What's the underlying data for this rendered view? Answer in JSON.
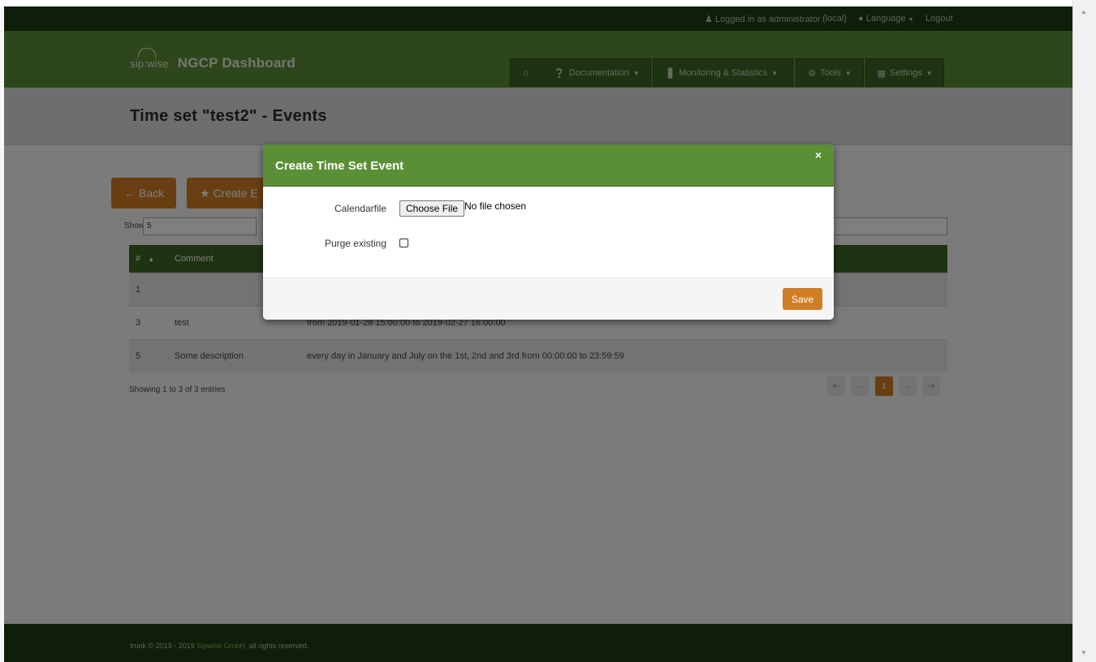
{
  "topbar": {
    "logged_in": "Logged in as administrator",
    "realm": "(local)",
    "language": "Language",
    "logout": "Logout"
  },
  "brand": {
    "logo_text": "sip:wise",
    "title": "NGCP Dashboard"
  },
  "nav": {
    "home_icon": "home-icon",
    "documentation": "Documentation",
    "monitoring": "Monitoring & Statistics",
    "tools": "Tools",
    "settings": "Settings"
  },
  "page": {
    "title": "Time set \"test2\" - Events"
  },
  "actions": {
    "back": "Back",
    "create": "Create E"
  },
  "list_controls": {
    "show_label": "Show",
    "show_value": "5"
  },
  "table": {
    "columns": [
      "#",
      "Comment",
      "",
      ""
    ],
    "rows": [
      {
        "id": "1",
        "comment": "",
        "description": ""
      },
      {
        "id": "3",
        "comment": "test",
        "description": "from 2019-01-28 15:00:00 to 2019-02-27 16:00:00"
      },
      {
        "id": "5",
        "comment": "Some description",
        "description": "every day in January and July on the 1st, 2nd and 3rd from 00:00:00 to 23:59:59"
      }
    ]
  },
  "pagination": {
    "summary": "Showing 1 to 3 of 3 entries",
    "first": "⇤",
    "prev": "←",
    "current": "1",
    "next": "→",
    "last": "⇥"
  },
  "footer": {
    "prefix": "trunk © 2013 - 2019",
    "company": "Sipwise GmbH",
    "suffix": ", all rights reserved."
  },
  "modal": {
    "title": "Create Time Set Event",
    "close": "×",
    "calendarfile_label": "Calendarfile",
    "choose_file": "Choose File",
    "no_file": "No file chosen",
    "purge_label": "Purge existing",
    "save": "Save"
  },
  "colors": {
    "header_green": "#5a8f35",
    "dark_green": "#3d6624",
    "accent_orange": "#d07d24"
  }
}
